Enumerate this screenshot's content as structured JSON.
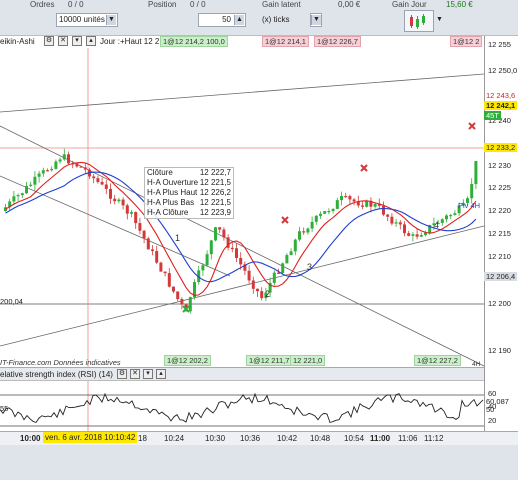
{
  "topbar": {
    "orders_label": "Ordres",
    "orders_value": "0 / 0",
    "position_label": "Position",
    "position_value": "0 / 0",
    "latent_label": "Gain latent",
    "latent_value": "0,00 €",
    "day_gain_label": "Gain Jour",
    "day_gain_value": "15,60 €",
    "units_select": "10000 unités",
    "ticks_value": "50",
    "ticks_unit": "(x) ticks"
  },
  "chart": {
    "title_left": "eikin-Ashi",
    "title_info": "Jour :+Haut 12 2",
    "pill_top_1": "1@12 214,1",
    "pill_top_2": "1@12 226,7",
    "pill_top_3": "1@12 2",
    "pill_overlay": "1@12 214,2  100,0",
    "pill_bot_1": "1@12 202,2",
    "pill_bot_2": "1@12 211,7",
    "pill_bot_3": "12 221,0",
    "pill_bot_4": "1@12 227,2",
    "left_level": "200,04",
    "watermark": "IT-Finance.com  Données indicatives",
    "pivot_label": "Piv 4H",
    "label_4h": "4H",
    "wave_1": "1",
    "wave_2": "2",
    "wave_3": "3",
    "wave_4": "4",
    "info": {
      "close_label": "Clôture",
      "close_value": "12 222,7",
      "ha_open_label": "H-A Ouverture",
      "ha_open_value": "12 221,5",
      "ha_high_label": "H-A Plus Haut",
      "ha_high_value": "12 226,2",
      "ha_low_label": "H-A Plus Bas",
      "ha_low_value": "12 221,5",
      "ha_close_label": "H-A Clôture",
      "ha_close_value": "12 223,9"
    }
  },
  "price_axis": {
    "labels": [
      "12 255",
      "12 250,0",
      "12 245",
      "12 240",
      "12 235",
      "12 230",
      "12 225",
      "12 220",
      "12 215",
      "12 210",
      "12 205",
      "12 200",
      "12 195",
      "12 190"
    ],
    "tag_243": "12 243,6",
    "tag_242": "12 242,1",
    "tag_45t": "45T",
    "tag_233": "12 233,2",
    "tag_206": "12 206,4"
  },
  "rsi": {
    "title": "elative strength index (RSI) (14)",
    "left_val": "55",
    "axis_labels": [
      "60",
      "40",
      "20"
    ],
    "tag_1": "60,087",
    "tag_2": "50"
  },
  "timeaxis": {
    "labels": [
      "10:00",
      "18",
      "10:24",
      "10:30",
      "10:36",
      "10:42",
      "10:48",
      "10:54",
      "11:00",
      "11:06",
      "11:12"
    ],
    "cursor_label": "ven. 6 avr. 2018 10:10:42"
  },
  "colors": {
    "bull": "#2fae3a",
    "bear": "#d23a3a",
    "ma_fast": "#e02020",
    "ma_slow": "#2040d0",
    "pill_green": "#c9f0c9",
    "pill_red": "#f6d0d6"
  }
}
